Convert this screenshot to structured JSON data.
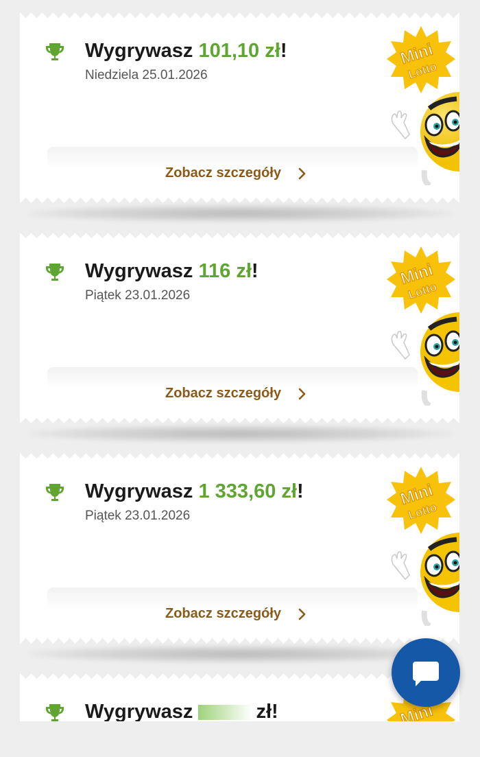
{
  "colors": {
    "amount_green": "#5fa531",
    "link_brown": "#8a5a1a",
    "logo_yellow": "#f8c20a",
    "chat_blue": "#1658a8"
  },
  "cards": [
    {
      "prefix": "Wygrywasz ",
      "amount": "101,10 zł",
      "suffix": "!",
      "date": "Niedziela 25.01.2026",
      "link": "Zobacz szczegóły",
      "logo_line1": "Mini",
      "logo_line2": "Lotto"
    },
    {
      "prefix": "Wygrywasz ",
      "amount": "116 zł",
      "suffix": "!",
      "date": "Piątek 23.01.2026",
      "link": "Zobacz szczegóły",
      "logo_line1": "Mini",
      "logo_line2": "Lotto"
    },
    {
      "prefix": "Wygrywasz ",
      "amount": "1 333,60 zł",
      "suffix": "!",
      "date": "Piątek 23.01.2026",
      "link": "Zobacz szczegóły",
      "logo_line1": "Mini",
      "logo_line2": "Lotto"
    },
    {
      "prefix": "Wygrywasz ",
      "amount": "zł",
      "suffix": "!",
      "logo_line1": "Mini"
    }
  ],
  "icons": {
    "trophy": "trophy-icon",
    "chevron": "chevron-right-icon",
    "chat": "chat-bubble-icon"
  }
}
